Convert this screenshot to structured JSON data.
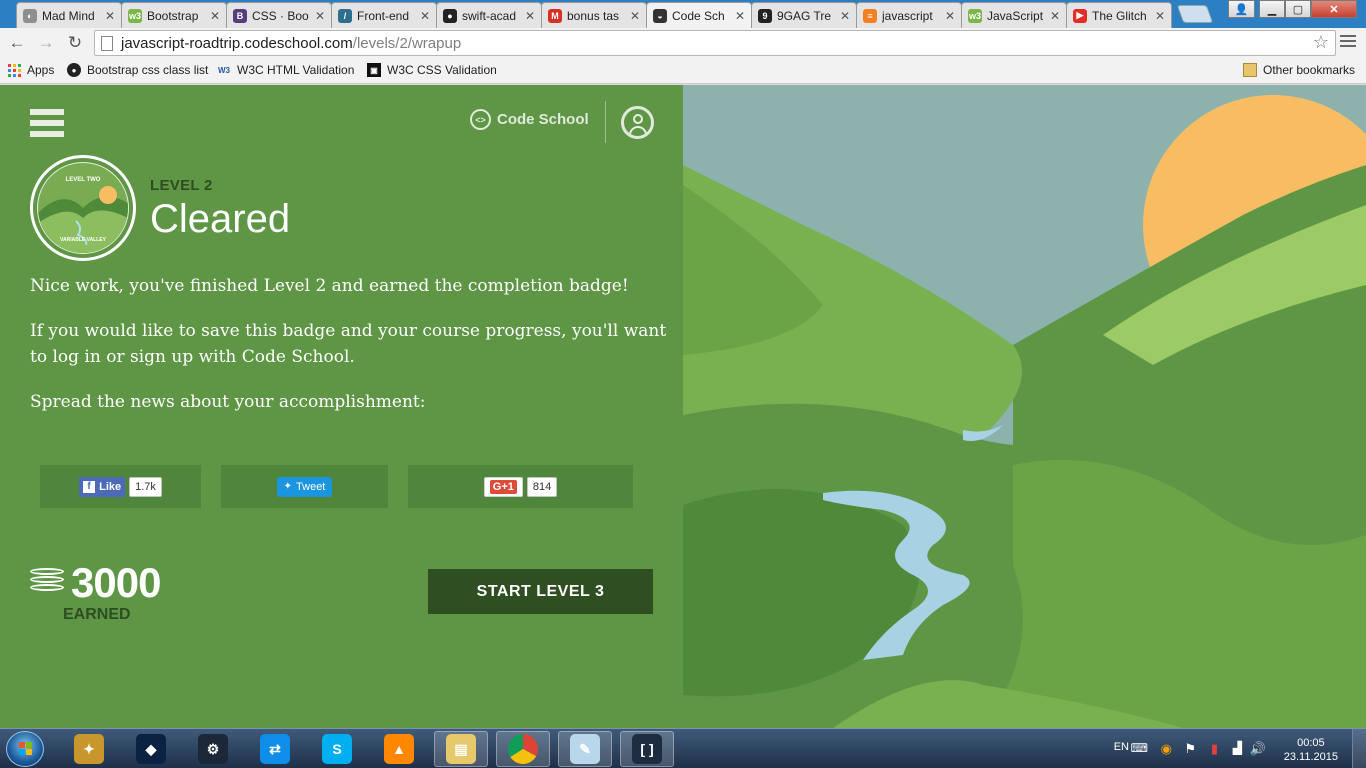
{
  "browser": {
    "tabs": [
      {
        "title": "Mad Mind",
        "icon": "mm",
        "icon_color": "#8e8e8e"
      },
      {
        "title": "Bootstrap",
        "icon": "w3",
        "icon_color": "#7ab648"
      },
      {
        "title": "CSS · Boo",
        "icon": "B",
        "icon_color": "#563d7c"
      },
      {
        "title": "Front-end",
        "icon": "fe",
        "icon_color": "#2e6f8f"
      },
      {
        "title": "swift-acad",
        "icon": "gh",
        "icon_color": "#222222"
      },
      {
        "title": "bonus tas",
        "icon": "M",
        "icon_color": "#d93025"
      },
      {
        "title": "Code Sch",
        "icon": "cs",
        "icon_color": "#333333",
        "active": true
      },
      {
        "title": "9GAG Tre",
        "icon": "9",
        "icon_color": "#222222"
      },
      {
        "title": "javascript",
        "icon": "so",
        "icon_color": "#f48024"
      },
      {
        "title": "JavaScript",
        "icon": "w3",
        "icon_color": "#7ab648"
      },
      {
        "title": "The Glitch",
        "icon": "yt",
        "icon_color": "#e52d27"
      }
    ],
    "url_host": "javascript-roadtrip.codeschool.com",
    "url_path": "/levels/2/wrapup",
    "bookmarks": [
      {
        "label": "Apps",
        "icon": "apps-grid"
      },
      {
        "label": "Bootstrap css class list",
        "icon": "github-icon"
      },
      {
        "label": "W3C HTML Validation",
        "icon": "w3c-icon"
      },
      {
        "label": "W3C CSS Validation",
        "icon": "w3c-css-icon"
      }
    ],
    "other_bookmarks": "Other bookmarks"
  },
  "page": {
    "brand": "Code School",
    "badge": {
      "top": "LEVEL TWO",
      "bottom": "VARIABLE VALLEY",
      "script": "Tumbled"
    },
    "level_label": "LEVEL 2",
    "status": "Cleared",
    "paragraphs": [
      "Nice work, you've finished Level 2 and earned the completion badge!",
      "If you would like to save this badge and your course progress, you'll want to log in or sign up with Code School.",
      "Spread the news about your accomplishment:"
    ],
    "share": {
      "facebook_label": "Like",
      "facebook_count": "1.7k",
      "twitter_label": "Tweet",
      "gplus_label": "G+1",
      "gplus_count": "814"
    },
    "points": "3000",
    "points_label": "EARNED",
    "cta": "START LEVEL 3"
  },
  "taskbar": {
    "apps": [
      "Hearthstone",
      "Battle.net",
      "Steam",
      "TeamViewer",
      "Skype",
      "VLC media player",
      "Windows Explorer",
      "Google Chrome",
      "Notepad",
      "Brackets"
    ],
    "language": "EN",
    "time": "00:05",
    "date": "23.11.2015 г."
  },
  "colors": {
    "page_green": "#5e9646",
    "dark_green": "#2f4f23",
    "sky": "#8db2ae",
    "sun": "#f8bd63"
  }
}
